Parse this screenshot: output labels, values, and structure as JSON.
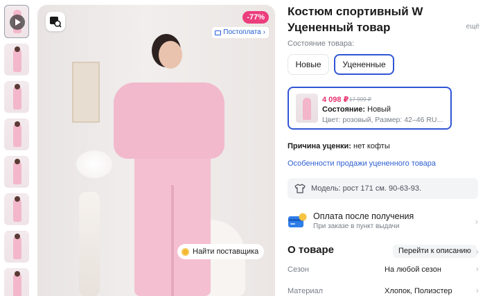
{
  "gallery": {
    "thumbnail_count": 8,
    "discount_badge": "-77%",
    "postpay_label": "Постоплата",
    "find_supplier_label": "Найти поставщика"
  },
  "product": {
    "title": "Костюм спортивный W Уцененный товар",
    "more_label": "ещё"
  },
  "condition": {
    "label": "Состояние товара:",
    "options": [
      "Новые",
      "Уцененные"
    ],
    "selected": "Уцененные"
  },
  "offer_card": {
    "price": "4 098 ₽",
    "old_price": "17 999 ₽",
    "state_label": "Состояние:",
    "state_value": "Новый",
    "color_size": "Цвет: розовый, Размер: 42–46 RU..."
  },
  "markdown": {
    "reason_label": "Причина уценки:",
    "reason_value": "нет кофты",
    "features_link": "Особенности продажи уцененного товара"
  },
  "model_info": "Модель: рост 171 см. 90-63-93.",
  "payment": {
    "title": "Оплата после получения",
    "subtitle": "При заказе в пункт выдачи"
  },
  "about": {
    "heading": "О товаре",
    "goto_description": "Перейти к описанию",
    "specs": [
      {
        "key": "Сезон",
        "value": "На любой сезон"
      },
      {
        "key": "Материал",
        "value": "Хлопок, Полиэстер"
      }
    ]
  },
  "colors": {
    "accent_blue": "#2f55d4",
    "link_blue": "#2d5fd0",
    "price_pink": "#e8336e",
    "discount_pink": "#ec3d7c"
  }
}
